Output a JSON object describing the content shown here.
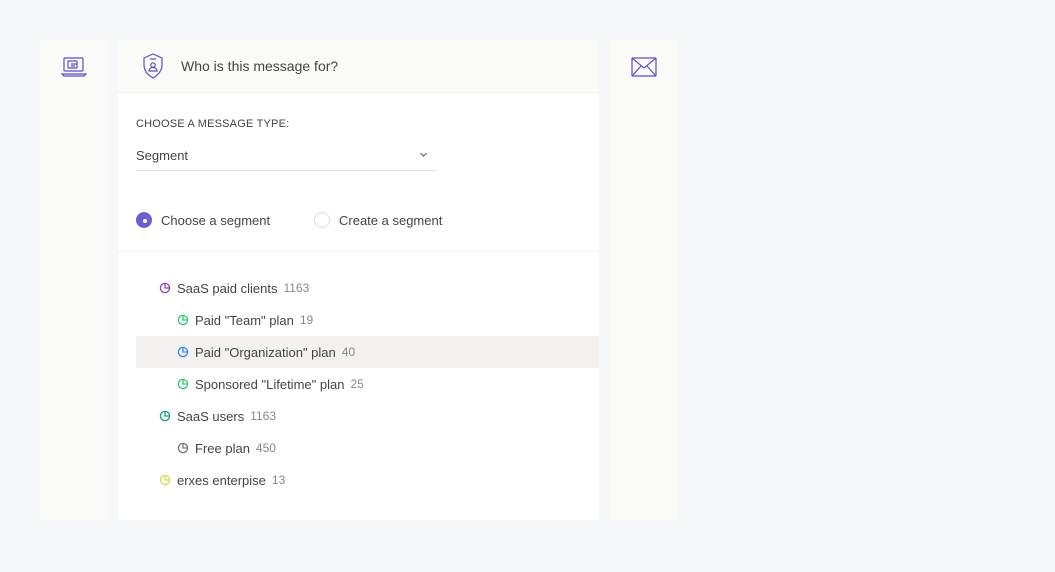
{
  "header": {
    "title": "Who is this message for?"
  },
  "message_type": {
    "label": "CHOOSE A MESSAGE TYPE:",
    "selected": "Segment"
  },
  "radio": {
    "choose_label": "Choose a segment",
    "create_label": "Create a segment",
    "selected": "choose"
  },
  "segments": [
    {
      "name": "SaaS paid clients",
      "count": "1163",
      "color": "#8e44ad",
      "level": 0,
      "highlighted": false
    },
    {
      "name": "Paid \"Team\" plan",
      "count": "19",
      "color": "#2ecc71",
      "level": 1,
      "highlighted": false
    },
    {
      "name": "Paid \"Organization\" plan",
      "count": "40",
      "color": "#3b82f6",
      "level": 1,
      "highlighted": true
    },
    {
      "name": "Sponsored \"Lifetime\" plan",
      "count": "25",
      "color": "#2ecc71",
      "level": 1,
      "highlighted": false
    },
    {
      "name": "SaaS users",
      "count": "1163",
      "color": "#16a085",
      "level": 0,
      "highlighted": false
    },
    {
      "name": "Free plan",
      "count": "450",
      "color": "#777777",
      "level": 1,
      "highlighted": false
    },
    {
      "name": "erxes enterpise",
      "count": "13",
      "color": "#c6e648",
      "level": 0,
      "highlighted": false
    }
  ],
  "icons": {
    "left_panel": "devices-icon",
    "header": "shield-user-icon",
    "right_panel": "envelope-icon",
    "select": "chevron-down-icon",
    "segment": "pie-chart-icon"
  },
  "colors": {
    "accent": "#6a5fd3",
    "icon_primary": "#5b50c8"
  }
}
